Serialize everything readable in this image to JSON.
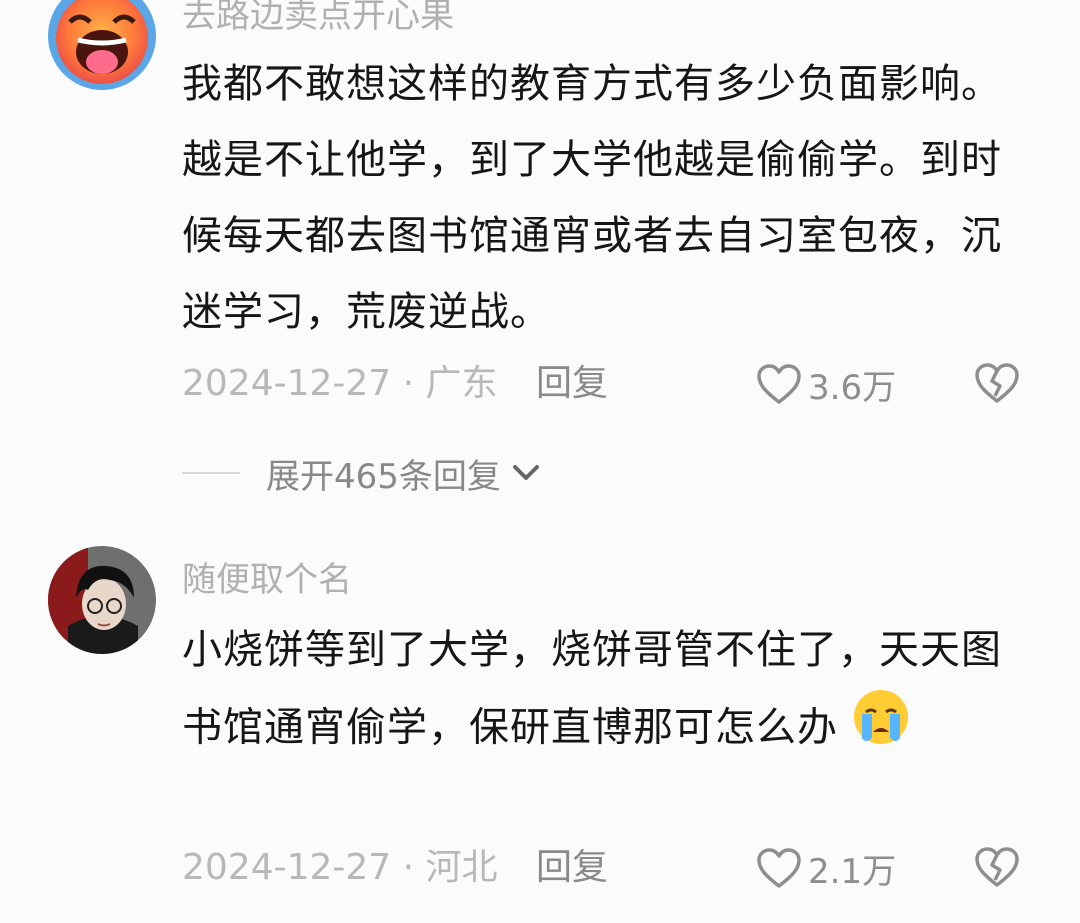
{
  "comments": [
    {
      "username": "去路边卖点开心果",
      "text": "我都不敢想这样的教育方式有多少负面影响。越是不让他学，到了大学他越是偷偷学。到时候每天都去图书馆通宵或者去自习室包夜，沉迷学习，荒废逆战。",
      "date_location": "2024-12-27 · 广东",
      "reply_label": "回复",
      "like_count": "3.6万"
    },
    {
      "username": "随便取个名",
      "text": "小烧饼等到了大学，烧饼哥管不住了，天天图书馆通宵偷学，保研直博那可怎么办",
      "date_location": "2024-12-27 · 河北",
      "reply_label": "回复",
      "like_count": "2.1万"
    }
  ],
  "expand_replies_label": "展开465条回复",
  "icons": {
    "like": "heart-outline-icon",
    "dislike": "broken-heart-icon",
    "expand": "chevron-down-icon",
    "emoji": "crying-face-emoji"
  }
}
